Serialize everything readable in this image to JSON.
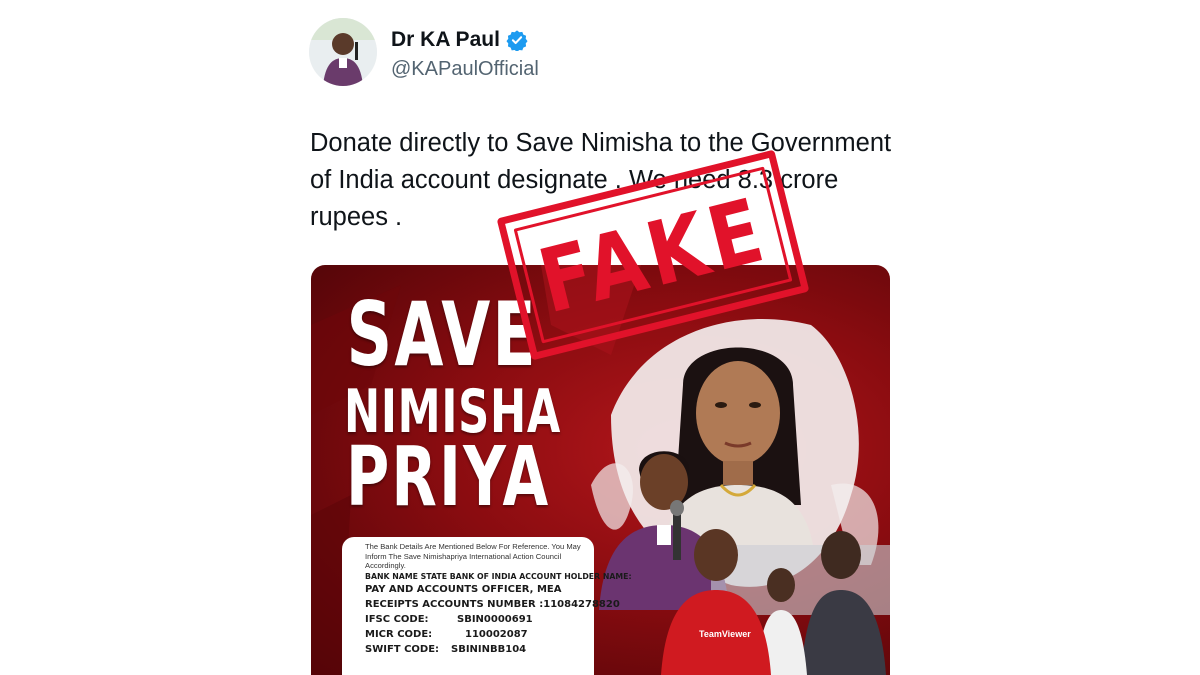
{
  "tweet": {
    "display_name": "Dr KA Paul",
    "handle": "@KAPaulOfficial",
    "verified": true,
    "text": "Donate directly to Save Nimisha to the Government of India account designate . We need 8.3 crore rupees ."
  },
  "poster": {
    "title_line1": "SAVE",
    "title_line2": "NIMISHA",
    "title_line3": "PRIYA",
    "bank_note": "The Bank Details Are Mentioned Below For Reference. You May Inform The Save Nimishapriya International Action Council Accordingly.",
    "bank_name_line": "BANK NAME  STATE BANK OF INDIA ACCOUNT HOLDER NAME:",
    "account_holder": "PAY AND ACCOUNTS OFFICER, MEA",
    "receipts_line": "RECEIPTS ACCOUNTS NUMBER :11084278820",
    "ifsc_label": "IFSC CODE:",
    "ifsc_value": "SBIN0000691",
    "micr_label": "MICR CODE:",
    "micr_value": "110002087",
    "swift_label": "SWIFT CODE:",
    "swift_value": "SBININBB104",
    "jersey_text": "TeamViewer"
  },
  "stamp": {
    "text": "FAKE",
    "color": "#e1122a"
  },
  "colors": {
    "verified_badge": "#1d9bf0",
    "poster_red": "#8a0c10"
  }
}
